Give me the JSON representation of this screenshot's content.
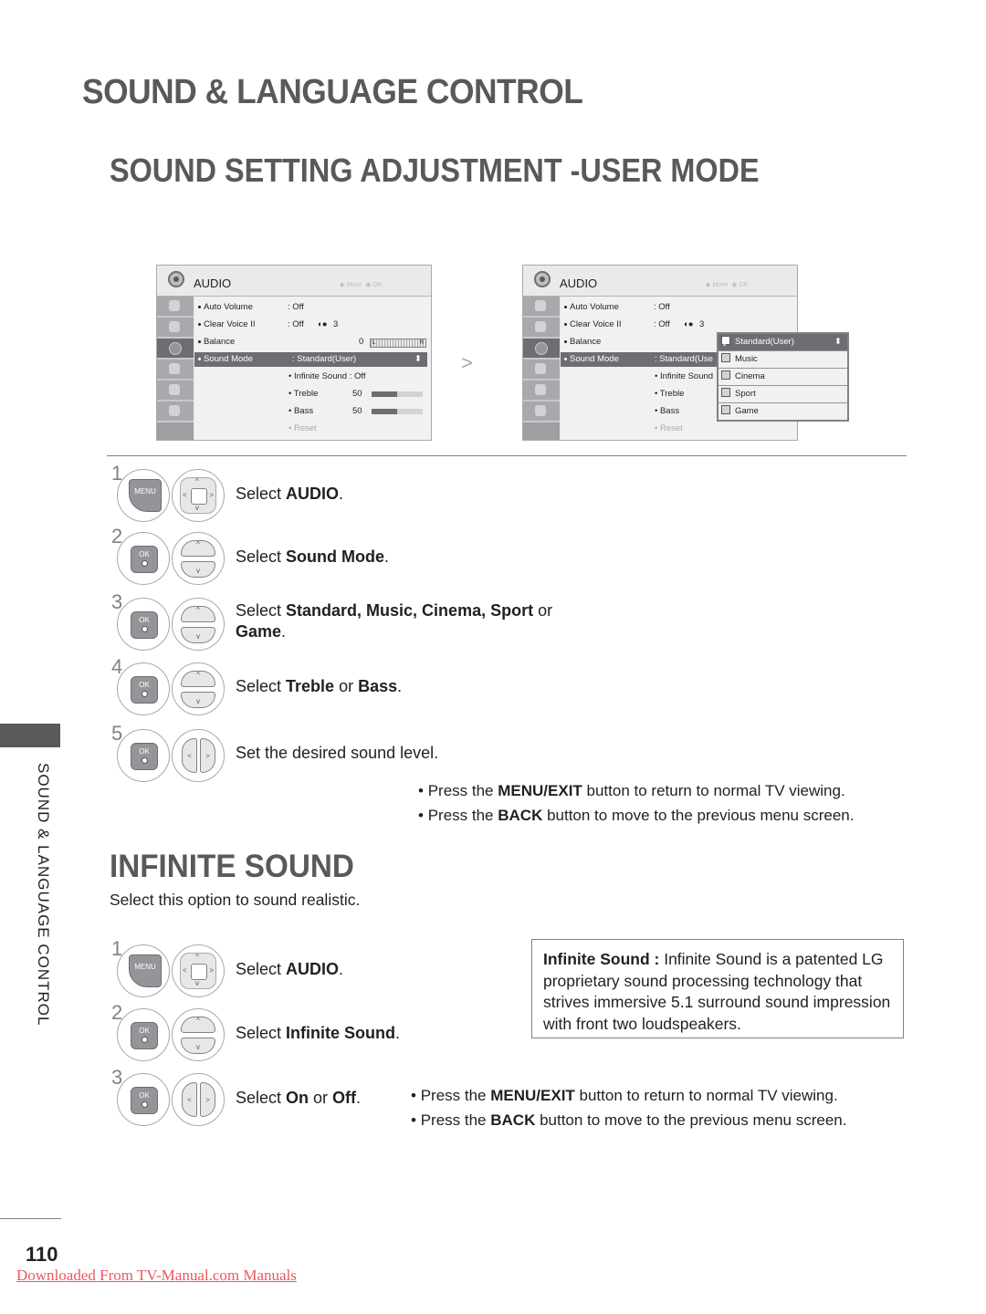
{
  "page": {
    "chapter_title": "SOUND & LANGUAGE CONTROL",
    "section_title": "SOUND SETTING ADJUSTMENT -USER MODE",
    "side_label": "SOUND & LANGUAGE CONTROL",
    "page_number": "110",
    "download_link": "Downloaded From TV-Manual.com Manuals"
  },
  "menu_left": {
    "title": "AUDIO",
    "hint_move": "Move",
    "hint_ok": "OK",
    "icons": [
      "picture-icon",
      "screen-icon",
      "audio-icon",
      "time-icon",
      "lock-icon",
      "option-icon"
    ],
    "items": [
      {
        "label": "Auto Volume",
        "value": ": Off"
      },
      {
        "label": "Clear Voice II",
        "value": ": Off",
        "extra": "3"
      },
      {
        "label": "Balance",
        "value": "0",
        "balance_left": "L",
        "balance_right": "R"
      },
      {
        "label": "Sound Mode",
        "value": ": Standard(User)"
      }
    ],
    "sub_items": [
      {
        "label": "Infinite Sound : Off"
      },
      {
        "label": "Treble",
        "value": "50",
        "level": 0.5
      },
      {
        "label": "Bass",
        "value": "50",
        "level": 0.5
      },
      {
        "label": "Reset"
      }
    ]
  },
  "menu_right": {
    "title": "AUDIO",
    "hint_move": "Move",
    "hint_ok": "OK",
    "items": [
      {
        "label": "Auto Volume",
        "value": ": Off"
      },
      {
        "label": "Clear Voice II",
        "value": ": Off",
        "extra": "3"
      },
      {
        "label": "Balance"
      },
      {
        "label": "Sound Mode",
        "value": ": Standard(Use"
      }
    ],
    "sub_items": [
      {
        "label": "Infinite Sound"
      },
      {
        "label": "Treble"
      },
      {
        "label": "Bass"
      },
      {
        "label": "Reset"
      }
    ],
    "dropdown": [
      {
        "label": "Standard(User)",
        "checked": true
      },
      {
        "label": "Music",
        "checked": false
      },
      {
        "label": "Cinema",
        "checked": false
      },
      {
        "label": "Sport",
        "checked": false
      },
      {
        "label": "Game",
        "checked": false
      }
    ]
  },
  "steps_user_mode": [
    {
      "num": "1",
      "pre": "Select ",
      "bold": "AUDIO",
      "post": "."
    },
    {
      "num": "2",
      "pre": "Select ",
      "bold": "Sound Mode",
      "post": "."
    },
    {
      "num": "3",
      "pre": "Select ",
      "bold": "Standard, Music, Cinema, Sport",
      "post": " or",
      "line2_bold": "Game",
      "line2_post": "."
    },
    {
      "num": "4",
      "pre": "Select ",
      "bold": "Treble",
      "mid": " or ",
      "bold2": "Bass",
      "post": "."
    },
    {
      "num": "5",
      "pre": "Set the desired sound level."
    }
  ],
  "notes_user_mode": [
    {
      "pre": "Press the ",
      "bold": "MENU/EXIT",
      "post": " button to return to normal TV viewing."
    },
    {
      "pre": "Press the ",
      "bold": "BACK",
      "post": " button to move to the previous menu screen."
    }
  ],
  "infinite": {
    "title": "INFINITE SOUND",
    "description": "Select this option to sound realistic.",
    "info_bold": "Infinite Sound : ",
    "info_text": "Infinite Sound is a patented LG proprietary sound processing technology that strives immersive 5.1 surround sound impression with front two loudspeakers.",
    "steps": [
      {
        "num": "1",
        "pre": "Select ",
        "bold": "AUDIO",
        "post": "."
      },
      {
        "num": "2",
        "pre": "Select ",
        "bold": "Infinite Sound",
        "post": "."
      },
      {
        "num": "3",
        "pre": "Select ",
        "bold": "On",
        "mid": " or ",
        "bold2": "Off",
        "post": "."
      }
    ],
    "notes": [
      {
        "pre": "Press the ",
        "bold": "MENU/EXIT",
        "post": " button to return to normal TV viewing."
      },
      {
        "pre": "Press the ",
        "bold": "BACK",
        "post": " button to move to the previous menu screen."
      }
    ]
  },
  "keys": {
    "menu": "MENU",
    "ok": "OK"
  }
}
